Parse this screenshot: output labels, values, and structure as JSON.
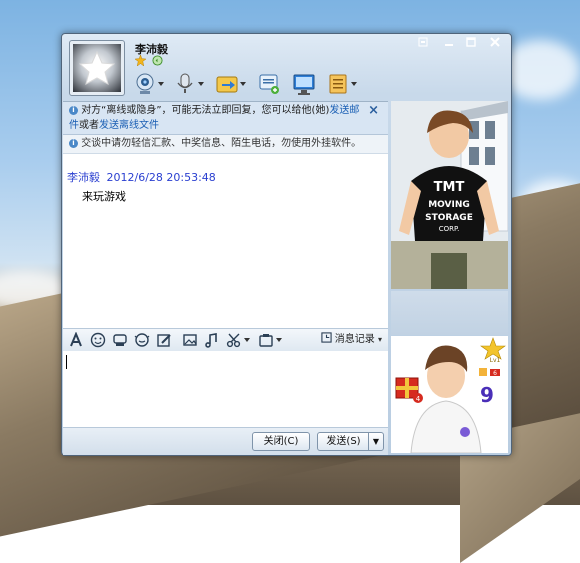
{
  "contact": {
    "name": "李沛毅"
  },
  "notice": {
    "offline_prefix": "对方“离线或隐身”，可能无法立即回复，您可以给他(她)",
    "send_mail_link": "发送邮件",
    "or_text": "或者",
    "send_offline_file_link": "发送离线文件",
    "close_glyph": "×",
    "safety_text": "交谈中请勿轻信汇款、中奖信息、陌生电话，勿使用外挂软件。"
  },
  "messages": [
    {
      "sender": "李沛毅",
      "time": "2012/6/28 20:53:48",
      "text": "来玩游戏"
    }
  ],
  "input_toolbar": {
    "history_label": "消息记录"
  },
  "buttons": {
    "close_label": "关闭(C)",
    "send_label": "发送(S)"
  },
  "window_controls": [
    "minimize-to-tray",
    "minimize",
    "maximize",
    "close"
  ],
  "avatar_show": {
    "tshirt_lines": [
      "TMT",
      "MOVING",
      "STORAGE",
      "CORP."
    ],
    "badge_level": "Lv1",
    "badge_num": "9"
  },
  "colors": {
    "sender": "#2a3fd0",
    "link": "#1a5fb4",
    "window_frame": "#c8d9ea"
  }
}
